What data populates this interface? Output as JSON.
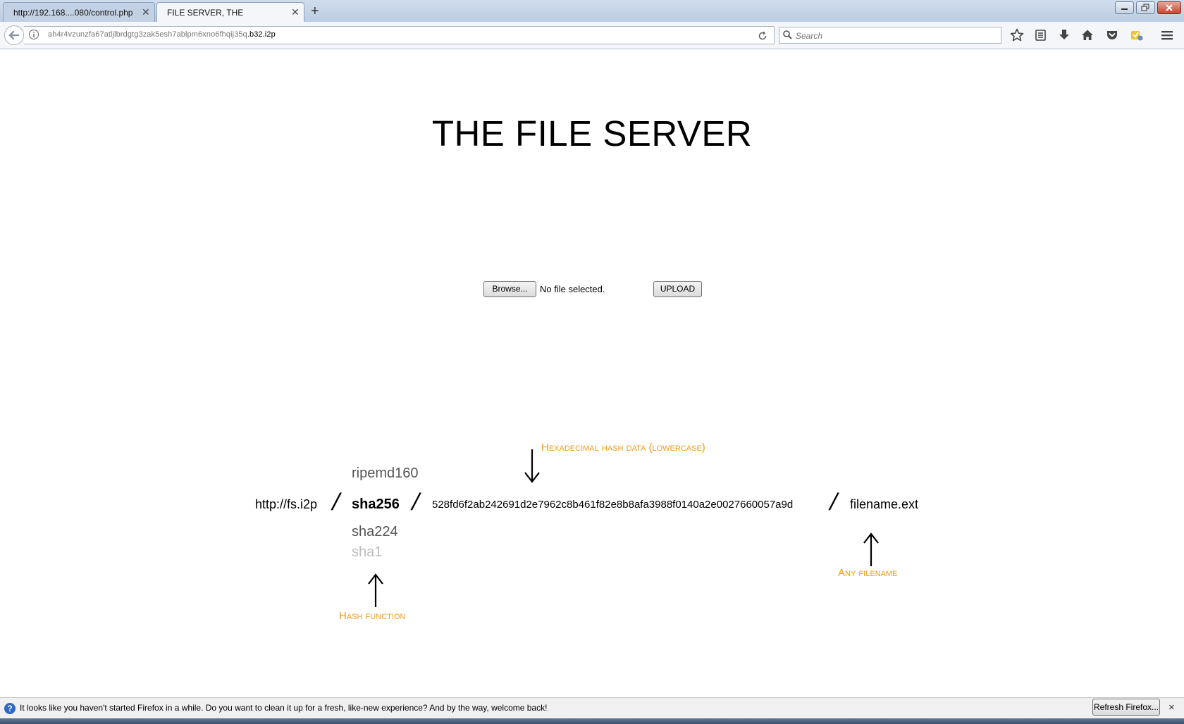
{
  "browser": {
    "tabs": [
      {
        "label": "http://192.168....080/control.php",
        "active": false
      },
      {
        "label": "FILE SERVER, THE",
        "active": true
      }
    ],
    "new_tab_glyph": "+",
    "url": {
      "prefix": "ah4r4vzunzfa67atljlbrdgtg3zak5esh7ablpm6xno6fhqij35q",
      "domain": ".b32.i2p"
    },
    "search_placeholder": "Search",
    "toolbar_icons": [
      "bookmark-star-icon",
      "reading-list-icon",
      "downloads-icon",
      "home-icon",
      "pocket-icon",
      "extension-icon",
      "menu-icon"
    ]
  },
  "page": {
    "title": "THE FILE SERVER",
    "upload": {
      "browse_label": "Browse...",
      "file_status": "No file selected.",
      "upload_label": "UPLOAD"
    },
    "diagram": {
      "base": "http://fs.i2p",
      "separator": "/",
      "hash_above": "ripemd160",
      "hash_selected": "sha256",
      "hash_below1": "sha224",
      "hash_below2": "sha1",
      "hash_value": "528fd6f2ab242691d2e7962c8b461f82e8b8afa3988f0140a2e0027660057a9d",
      "filename": "filename.ext",
      "annotations": {
        "hash_data": "Hexadecimal hash data (lowercase)",
        "hash_function": "Hash function",
        "any_filename": "Any filename"
      },
      "colors": {
        "annotation": "#f29a1c",
        "hash_dim": "#555555",
        "hash_faded": "#bdbdbd"
      }
    }
  },
  "notification": {
    "text": "It looks like you haven't started Firefox in a while. Do you want to clean it up for a fresh, like-new experience? And by the way, welcome back!",
    "button_label": "Refresh Firefox...",
    "close_glyph": "×",
    "info_glyph": "?"
  }
}
